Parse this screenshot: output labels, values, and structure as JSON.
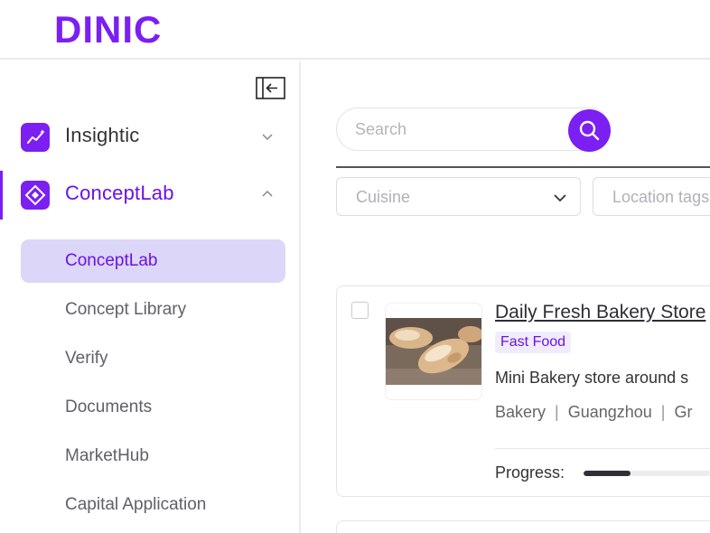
{
  "brand": {
    "logo_text": "DINIC",
    "color": "#7b1ff2"
  },
  "sidebar": {
    "groups": [
      {
        "label": "Insightic",
        "icon": "trend-chart-icon",
        "expanded": false
      },
      {
        "label": "ConceptLab",
        "icon": "diamond-icon",
        "expanded": true
      }
    ],
    "items": [
      {
        "label": "ConceptLab",
        "selected": true
      },
      {
        "label": "Concept Library"
      },
      {
        "label": "Verify"
      },
      {
        "label": "Documents"
      },
      {
        "label": "MarketHub"
      },
      {
        "label": "Capital Application"
      }
    ]
  },
  "search": {
    "placeholder": "Search",
    "value": ""
  },
  "filters": {
    "cuisine_placeholder": "Cuisine",
    "location_placeholder": "Location tags"
  },
  "cards": [
    {
      "title": "Daily Fresh Bakery Store",
      "tag": "Fast Food",
      "description": "Mini Bakery store around s",
      "meta": [
        "Bakery",
        "Guangzhou",
        "Gr"
      ],
      "progress_label": "Progress:",
      "progress": 0.37
    }
  ]
}
